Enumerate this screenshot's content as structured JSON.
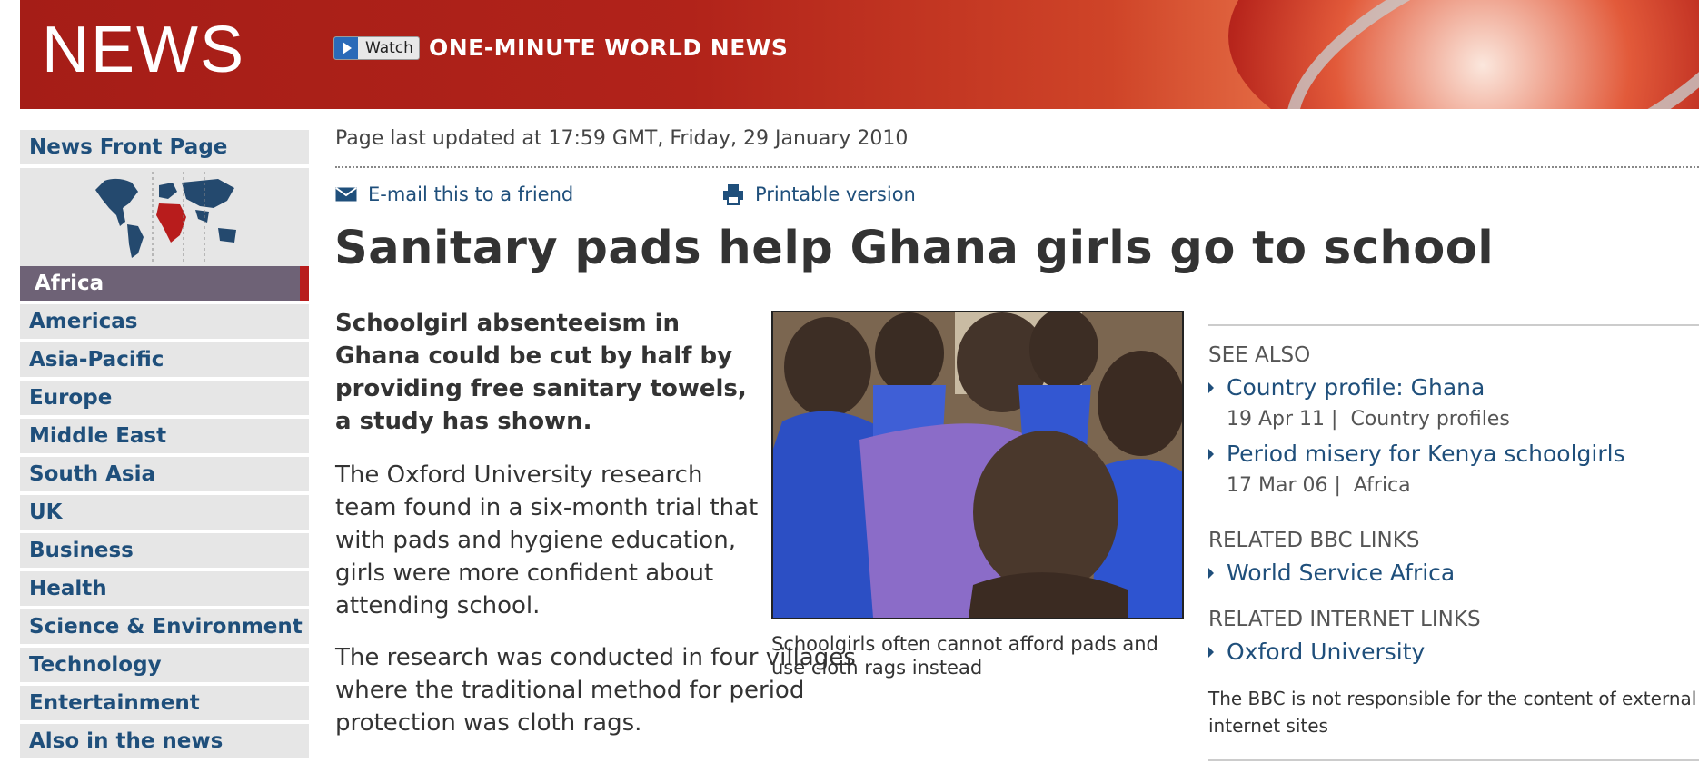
{
  "header": {
    "logo_text": "NEWS",
    "watch_label": "Watch",
    "watch_title": "ONE-MINUTE WORLD NEWS"
  },
  "nav": {
    "front_page": "News Front Page",
    "active": "Africa",
    "items": [
      "Americas",
      "Asia-Pacific",
      "Europe",
      "Middle East",
      "South Asia",
      "UK",
      "Business",
      "Health",
      "Science & Environment",
      "Technology",
      "Entertainment",
      "Also in the news"
    ]
  },
  "article": {
    "updated": "Page last updated at 17:59 GMT, Friday, 29 January 2010",
    "email_label": "E-mail this to a friend",
    "print_label": "Printable version",
    "headline": "Sanitary pads help Ghana girls go to school",
    "intro": "Schoolgirl absenteeism in Ghana could be cut by half by providing free sanitary towels, a study has shown.",
    "para1": "The Oxford University research team found in a six-month trial that with pads and hygiene education, girls were more confident about attending school.",
    "para2": "The research was conducted in four villages where the traditional method for period protection was cloth rags.",
    "caption": "Schoolgirls often cannot afford pads and use cloth rags instead"
  },
  "sidebar_right": {
    "see_also_heading": "SEE ALSO",
    "see_also": [
      {
        "title": "Country profile: Ghana",
        "date": "19 Apr 11",
        "section": "Country profiles"
      },
      {
        "title": "Period misery for Kenya schoolgirls",
        "date": "17 Mar 06",
        "section": "Africa"
      }
    ],
    "related_bbc_heading": "RELATED BBC LINKS",
    "related_bbc": [
      "World Service Africa"
    ],
    "related_internet_heading": "RELATED INTERNET LINKS",
    "related_internet": [
      "Oxford University"
    ],
    "disclaimer": "The BBC is not responsible for the content of external internet sites"
  },
  "colors": {
    "brand_red": "#a51d17",
    "link_blue": "#1f4f7b",
    "nav_active": "#6e6276"
  }
}
